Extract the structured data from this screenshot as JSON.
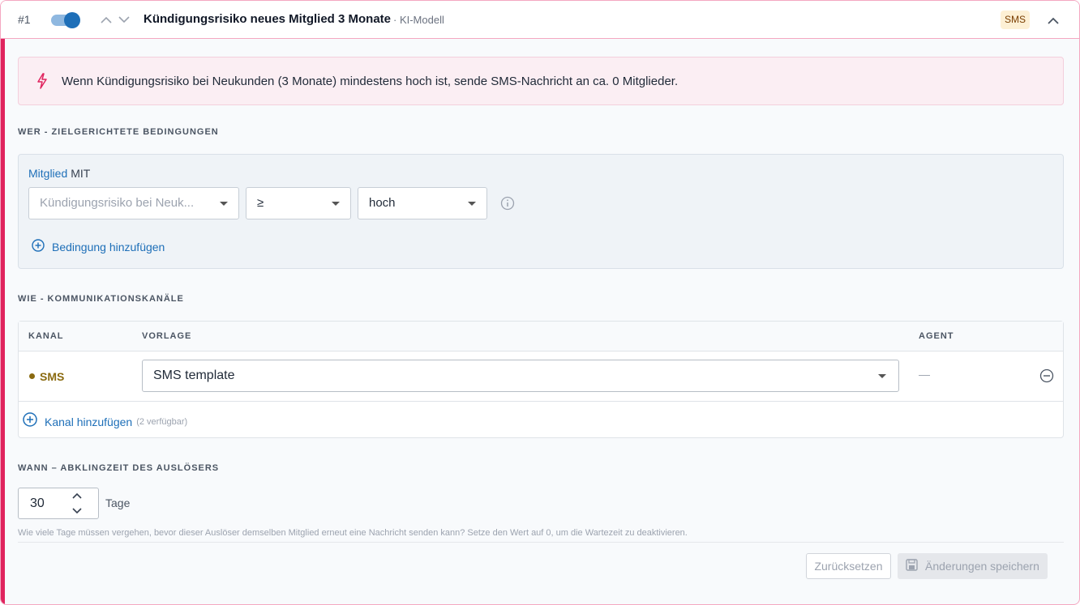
{
  "header": {
    "rule_number": "#1",
    "title": "Kündigungsrisiko neues Mitglied 3 Monate",
    "model_label": "· KI-Modell",
    "channel_badge": "SMS",
    "enabled": true
  },
  "summary": {
    "text": "Wenn Kündigungsrisiko bei Neukunden (3 Monate) mindestens hoch ist, sende SMS-Nachricht an ca. 0 Mitglieder."
  },
  "who": {
    "section_label": "WER - ZIELGERICHTETE BEDINGUNGEN",
    "entity": "Mitglied",
    "connector": "MIT",
    "condition": {
      "field_placeholder": "Kündigungsrisiko bei Neuk...",
      "operator": "≥",
      "value": "hoch"
    },
    "add_condition_label": "Bedingung hinzufügen"
  },
  "how": {
    "section_label": "WIE - KOMMUNIKATIONSKANÄLE",
    "columns": [
      "KANAL",
      "VORLAGE",
      "AGENT"
    ],
    "rows": [
      {
        "channel": "SMS",
        "template": "SMS template",
        "agent": "—"
      }
    ],
    "add_channel_label": "Kanal hinzufügen",
    "available_note": "(2 verfügbar)"
  },
  "when": {
    "section_label": "WANN – ABKLINGZEIT DES AUSLÖSERS",
    "cooldown_value": "30",
    "unit_label": "Tage",
    "help_text": "Wie viele Tage müssen vergehen, bevor dieser Auslöser demselben Mitglied erneut eine Nachricht senden kann? Setze den Wert auf 0, um die Wartezeit zu deaktivieren."
  },
  "actions": {
    "reset_label": "Zurücksetzen",
    "save_label": "Änderungen speichern"
  },
  "colors": {
    "accent": "#e0245e",
    "link": "#1e6fb8",
    "sms_channel": "#8a6a10"
  },
  "icons": {
    "toggle": "toggle-switch",
    "move_up": "chevron-up-icon",
    "move_down": "chevron-down-icon",
    "collapse": "chevron-up-icon",
    "summary": "lightning-icon",
    "info": "info-icon",
    "add": "plus-circle-icon",
    "remove": "minus-circle-icon",
    "save": "floppy-disk-icon"
  }
}
